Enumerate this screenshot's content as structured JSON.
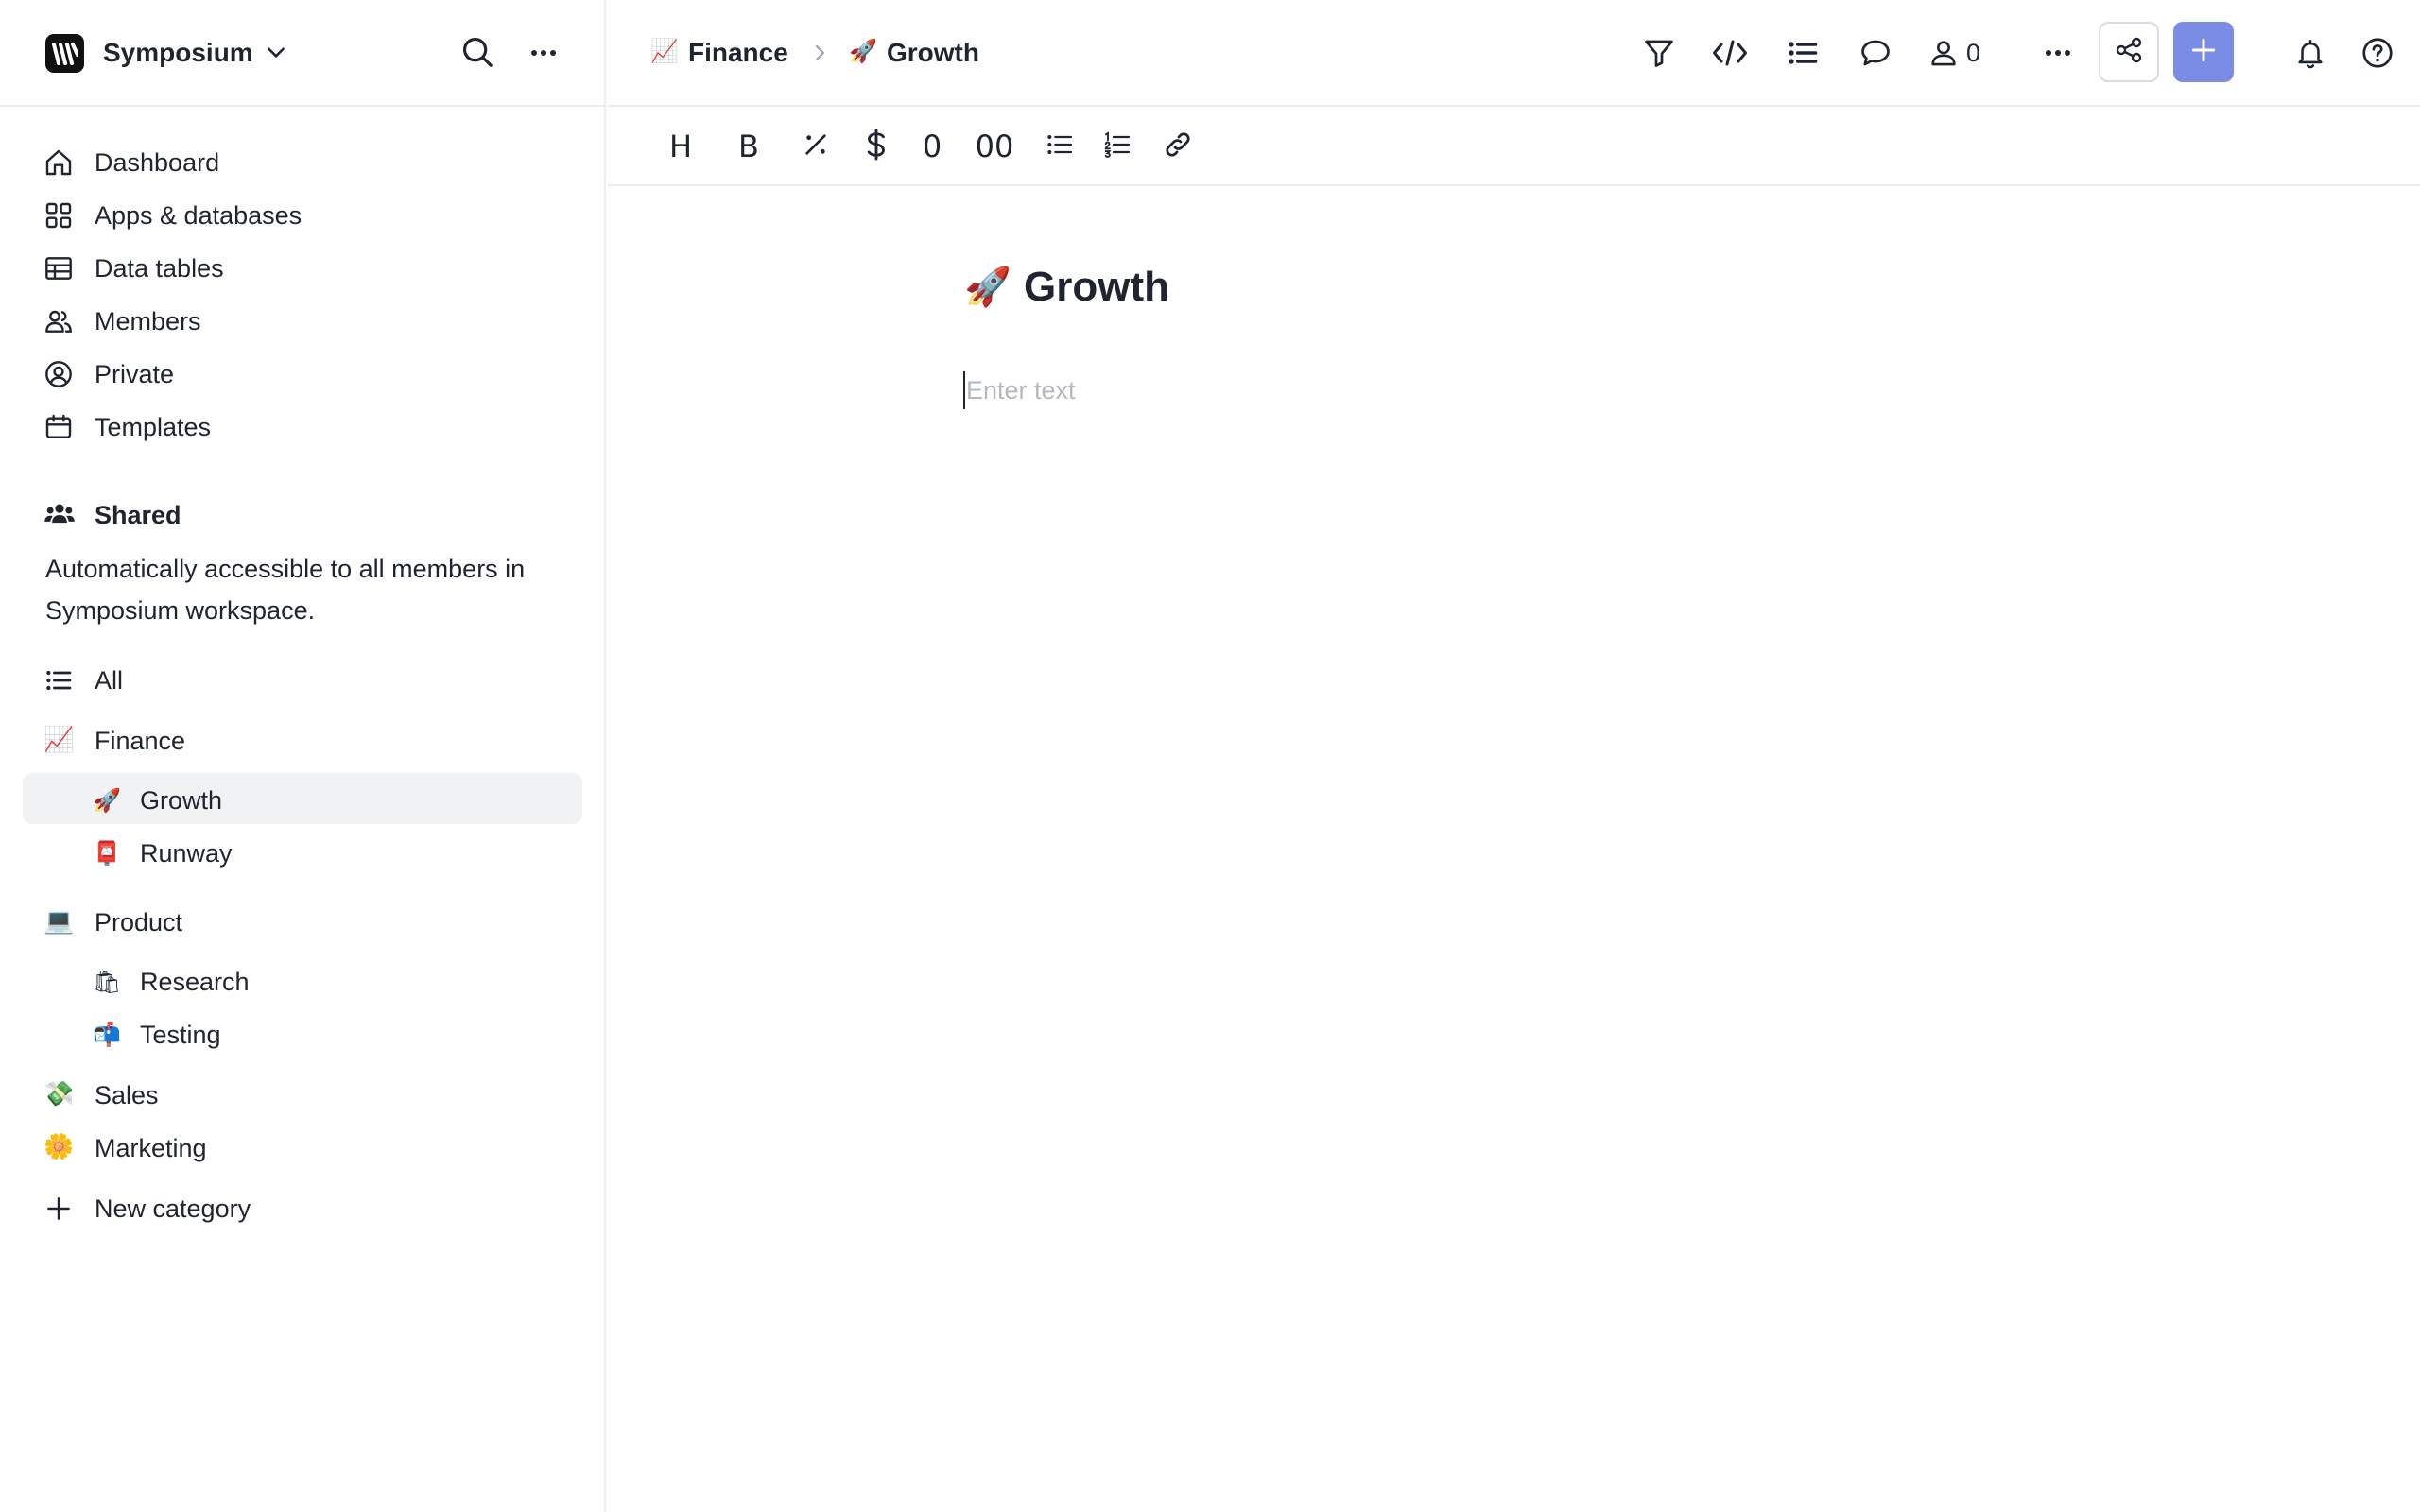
{
  "workspace": {
    "name": "Symposium"
  },
  "sidebar": {
    "nav": [
      {
        "label": "Dashboard",
        "icon": "home-icon"
      },
      {
        "label": "Apps & databases",
        "icon": "grid-icon"
      },
      {
        "label": "Data tables",
        "icon": "table-icon"
      },
      {
        "label": "Members",
        "icon": "members-icon"
      },
      {
        "label": "Private",
        "icon": "user-circle-icon"
      },
      {
        "label": "Templates",
        "icon": "calendar-icon"
      }
    ],
    "shared": {
      "title": "Shared",
      "description": "Automatically accessible to all members in Symposium workspace."
    },
    "all_label": "All",
    "categories": [
      {
        "label": "Finance",
        "emoji": "📈",
        "children": [
          {
            "label": "Growth",
            "emoji": "🚀",
            "active": true
          },
          {
            "label": "Runway",
            "emoji": "📮"
          }
        ]
      },
      {
        "label": "Product",
        "emoji": "💻",
        "children": [
          {
            "label": "Research",
            "emoji": "🛍"
          },
          {
            "label": "Testing",
            "emoji": "📬"
          }
        ]
      },
      {
        "label": "Sales",
        "emoji": "💸"
      },
      {
        "label": "Marketing",
        "emoji": "🌼"
      }
    ],
    "new_category_label": "New category"
  },
  "breadcrumb": [
    {
      "label": "Finance",
      "emoji": "📈"
    },
    {
      "label": "Growth",
      "emoji": "🚀"
    }
  ],
  "topbar": {
    "members_count": "0"
  },
  "toolbar": {
    "heading": "H",
    "bold": "B",
    "zero": "0",
    "double_zero": "00"
  },
  "document": {
    "emoji": "🚀",
    "title": "Growth",
    "placeholder": "Enter text"
  },
  "colors": {
    "accent": "#7b8ce6",
    "active_bg": "#f1f2f4",
    "border": "#eceef1",
    "text": "#1f2430",
    "placeholder": "#b4b8bf"
  }
}
